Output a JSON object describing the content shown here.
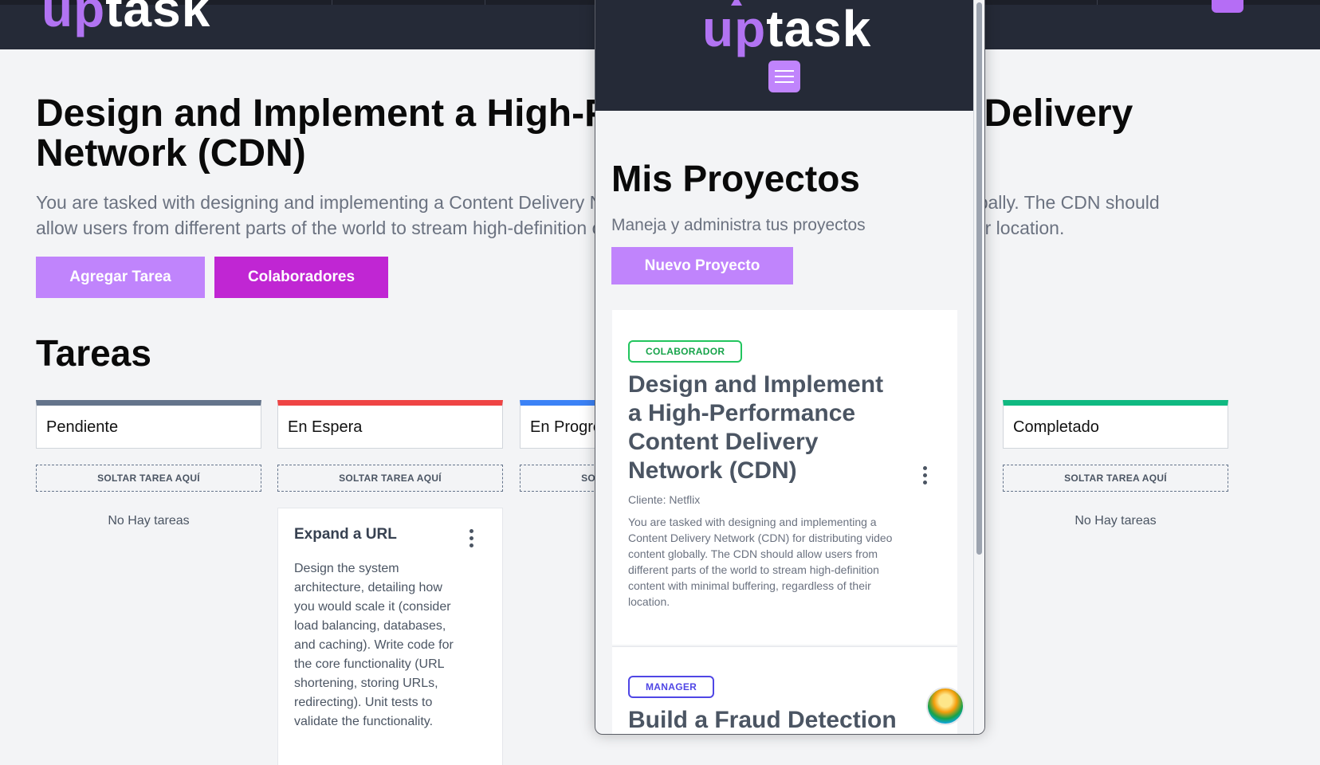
{
  "brand": {
    "logo_prefix": "up",
    "logo_suffix": "task"
  },
  "project": {
    "title": "Design and Implement a High-Performance Content Delivery Network (CDN)",
    "description": "You are tasked with designing and implementing a Content Delivery Network (CDN) for distributing video content globally. The CDN should allow users from different parts of the world to stream high-definition content with minimal buffering, regardless of their location.",
    "add_task_label": "Agregar Tarea",
    "collaborators_label": "Colaboradores"
  },
  "tasks_section": {
    "title": "Tareas"
  },
  "columns": [
    {
      "label": "Pendiente",
      "drop_label": "SOLTAR TAREA AQUÍ",
      "empty_label": "No Hay tareas",
      "color": "#64748b"
    },
    {
      "label": "En Espera",
      "drop_label": "SOLTAR TAREA AQUÍ",
      "color": "#ef4444",
      "task": {
        "title": "Expand a URL",
        "description": "Design the system architecture, detailing how you would scale it (consider load balancing, databases, and caching). Write code for the core functionality (URL shortening, storing URLs, redirecting). Unit tests to validate the functionality."
      }
    },
    {
      "label": "En Progreso",
      "drop_label": "SOLTAR TAREA AQUÍ",
      "color": "#3b82f6"
    },
    {
      "label": "Completado",
      "drop_label": "SOLTAR TAREA AQUÍ",
      "empty_label": "No Hay tareas",
      "color": "#10b981"
    }
  ],
  "popup": {
    "title": "Mis Proyectos",
    "subtitle": "Maneja y administra tus proyectos",
    "new_project_label": "Nuevo Proyecto",
    "projects": [
      {
        "badge": "COLABORADOR",
        "title": "Design and Implement a High-Performance Content Delivery Network (CDN)",
        "client": "Cliente: Netflix",
        "description": "You are tasked with designing and implementing a Content Delivery Network (CDN) for distributing video content globally. The CDN should allow users from different parts of the world to stream high-definition content with minimal buffering, regardless of their location."
      },
      {
        "badge": "MANAGER",
        "title": "Build a Fraud Detection"
      }
    ]
  },
  "icons": {
    "menu": "hamburger-icon",
    "kebab": "kebab-menu-icon",
    "avatar": "user-avatar"
  },
  "colors": {
    "header": "#252a37",
    "accent": "#c084fc",
    "accent_strong": "#c026d3",
    "collaborator_badge": "#22c55e",
    "manager_badge": "#4f46e5"
  }
}
